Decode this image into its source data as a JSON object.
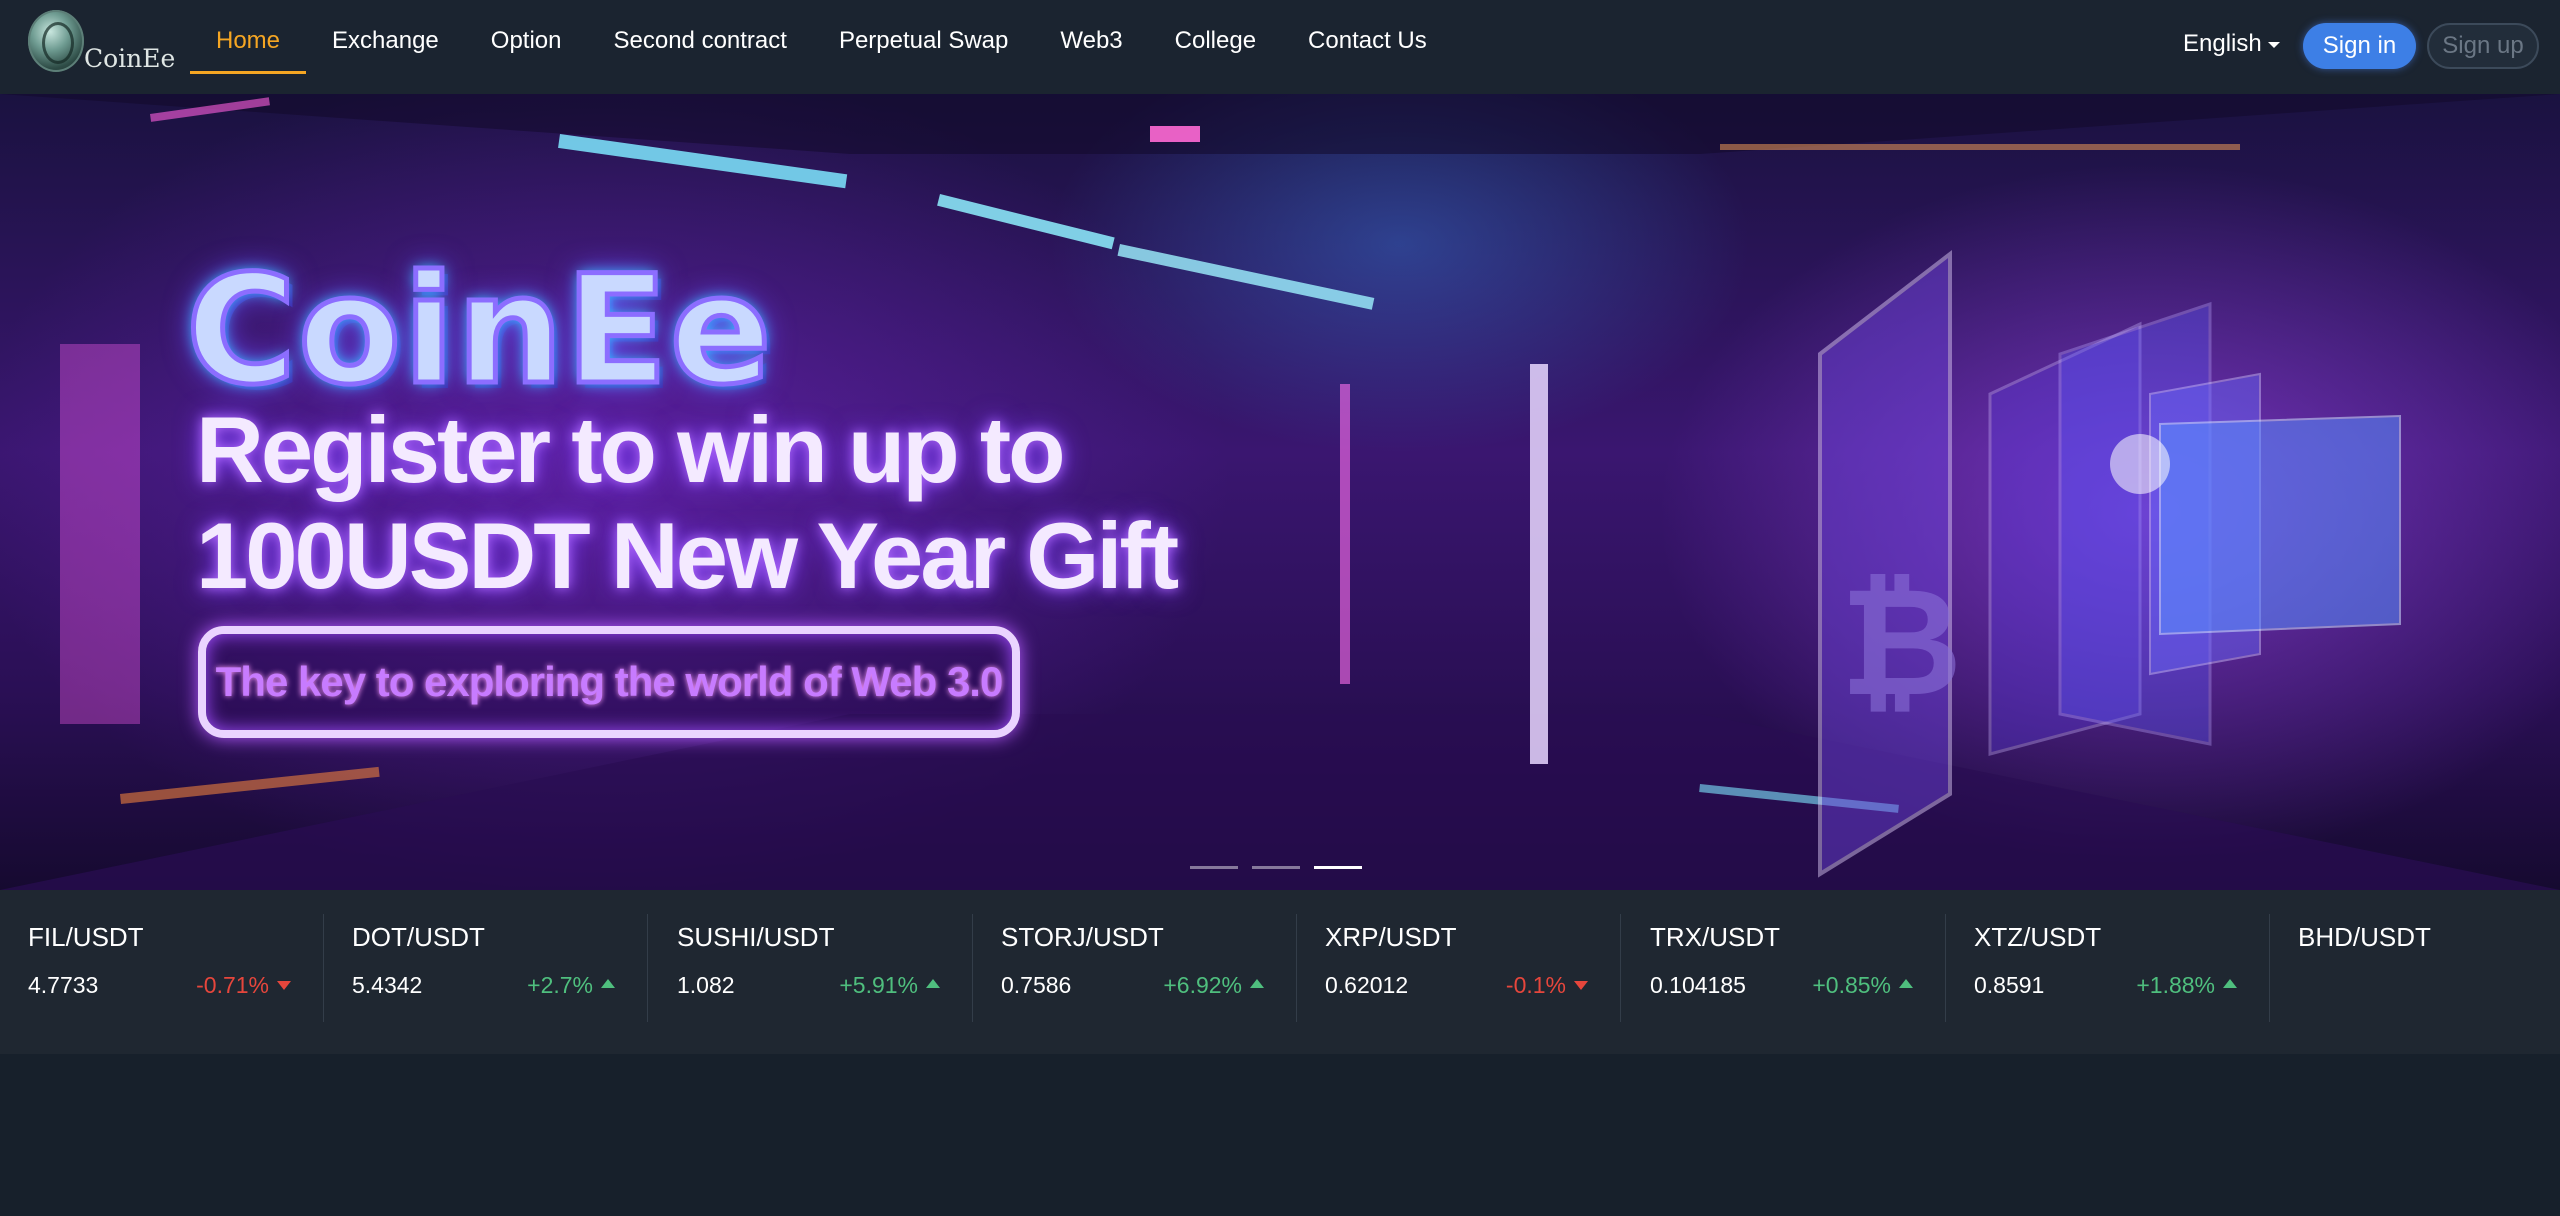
{
  "brand": {
    "name": "CoinEe"
  },
  "nav": {
    "items": [
      {
        "label": "Home",
        "active": true
      },
      {
        "label": "Exchange"
      },
      {
        "label": "Option"
      },
      {
        "label": "Second contract"
      },
      {
        "label": "Perpetual Swap"
      },
      {
        "label": "Web3"
      },
      {
        "label": "College"
      },
      {
        "label": "Contact Us"
      }
    ]
  },
  "header": {
    "language": "English",
    "sign_in": "Sign in",
    "sign_up": "Sign up"
  },
  "banner": {
    "logo_text": "CoinEe",
    "line1": "Register to win up to",
    "line2": "100USDT New Year Gift",
    "tagline": "The key to exploring the world of Web 3.0",
    "slides_total": 3,
    "active_slide": 3
  },
  "ticker": [
    {
      "pair": "FIL/USDT",
      "price": "4.7733",
      "change": "-0.71%",
      "direction": "down"
    },
    {
      "pair": "DOT/USDT",
      "price": "5.4342",
      "change": "+2.7%",
      "direction": "up"
    },
    {
      "pair": "SUSHI/USDT",
      "price": "1.082",
      "change": "+5.91%",
      "direction": "up"
    },
    {
      "pair": "STORJ/USDT",
      "price": "0.7586",
      "change": "+6.92%",
      "direction": "up"
    },
    {
      "pair": "XRP/USDT",
      "price": "0.62012",
      "change": "-0.1%",
      "direction": "down"
    },
    {
      "pair": "TRX/USDT",
      "price": "0.104185",
      "change": "+0.85%",
      "direction": "up"
    },
    {
      "pair": "XTZ/USDT",
      "price": "0.8591",
      "change": "+1.88%",
      "direction": "up"
    },
    {
      "pair": "BHD/USDT",
      "price": "",
      "change": "",
      "direction": "up"
    }
  ],
  "colors": {
    "accent": "#f5a623",
    "primary_button": "#3d7fe6",
    "up": "#4fbf7e",
    "down": "#e6463c",
    "header_bg": "#1b2430",
    "page_bg": "#17202b"
  }
}
